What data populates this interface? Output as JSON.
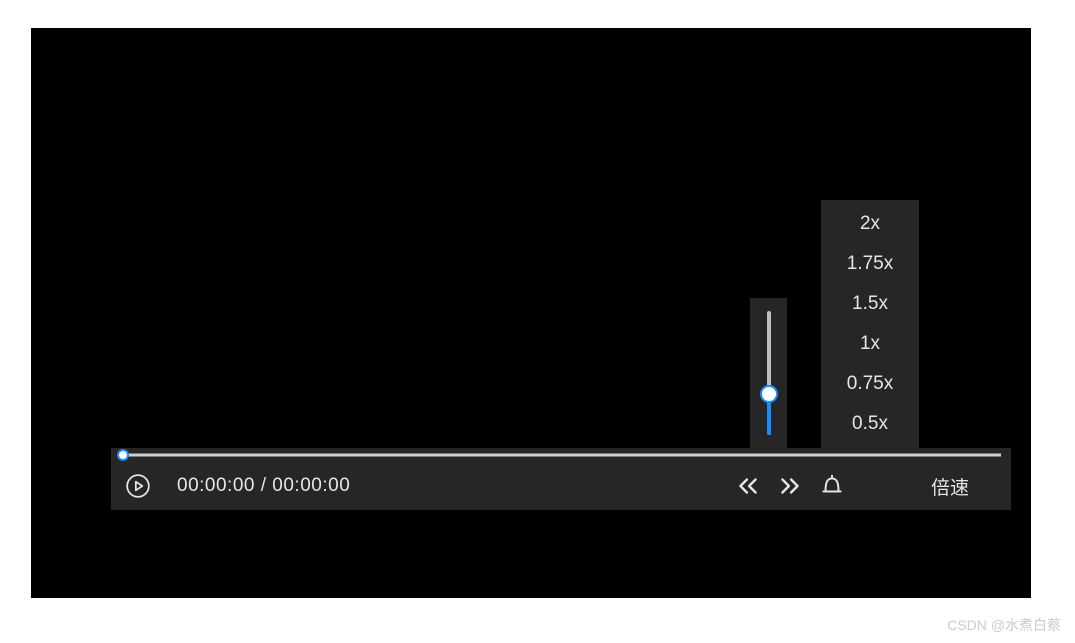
{
  "player": {
    "time_display": "00:00:00 / 00:00:00",
    "speed_label": "倍速",
    "speed_options": [
      "2x",
      "1.75x",
      "1.5x",
      "1x",
      "0.75x",
      "0.5x"
    ],
    "progress_percent": 0,
    "volume_percent": 32
  },
  "watermark": "CSDN @水煮白蔡"
}
